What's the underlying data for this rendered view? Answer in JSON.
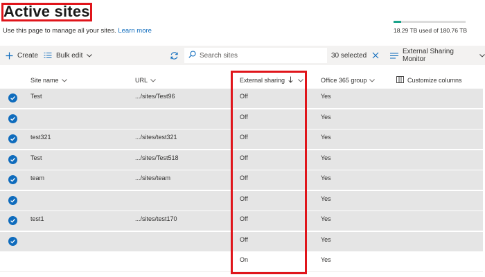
{
  "page": {
    "title": "Active sites",
    "subtitle": "Use this page to manage all your sites.",
    "learn_more": "Learn more"
  },
  "storage": {
    "text": "18.29 TB used of 180.76 TB",
    "fraction_used": 0.101
  },
  "toolbar": {
    "create_label": "Create",
    "bulk_edit_label": "Bulk edit",
    "search_placeholder": "Search sites",
    "selected_count": "30 selected",
    "view_label": "External Sharing Monitor"
  },
  "columns": {
    "site_name": "Site name",
    "url": "URL",
    "external_sharing": "External sharing",
    "office365_group": "Office 365 group",
    "customize": "Customize columns"
  },
  "rows": [
    {
      "selected": true,
      "name": "Test",
      "url": ".../sites/Test96",
      "sharing": "Off",
      "group": "Yes"
    },
    {
      "selected": true,
      "name": "",
      "url": "",
      "sharing": "Off",
      "group": "Yes"
    },
    {
      "selected": true,
      "name": "test321",
      "url": ".../sites/test321",
      "sharing": "Off",
      "group": "Yes"
    },
    {
      "selected": true,
      "name": "Test",
      "url": ".../sites/Test518",
      "sharing": "Off",
      "group": "Yes"
    },
    {
      "selected": true,
      "name": "team",
      "url": ".../sites/team",
      "sharing": "Off",
      "group": "Yes"
    },
    {
      "selected": true,
      "name": "",
      "url": "",
      "sharing": "Off",
      "group": "Yes"
    },
    {
      "selected": true,
      "name": "test1",
      "url": ".../sites/test170",
      "sharing": "Off",
      "group": "Yes"
    },
    {
      "selected": true,
      "name": "",
      "url": "",
      "sharing": "Off",
      "group": "Yes"
    },
    {
      "selected": false,
      "name": "",
      "url": "",
      "sharing": "On",
      "group": "Yes"
    }
  ],
  "colors": {
    "accent": "#0f6cbd",
    "highlight": "#e0151b",
    "storage": "#1ba38b",
    "selected_row": "#e5e5e5"
  }
}
